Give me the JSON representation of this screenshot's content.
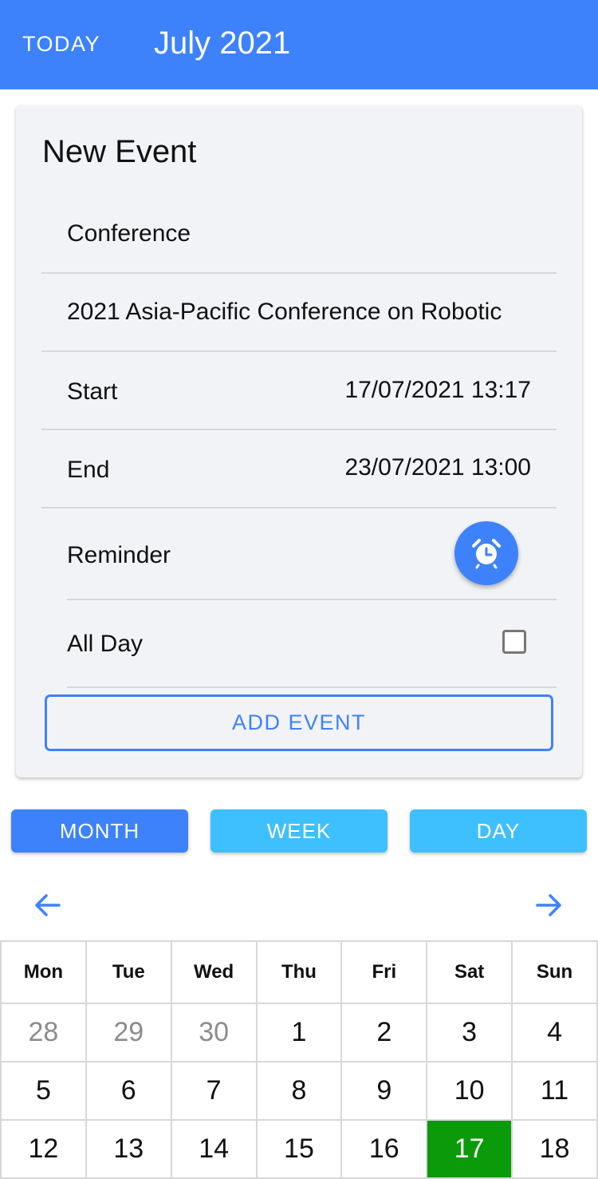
{
  "appbar": {
    "today_label": "TODAY",
    "month_title": "July 2021"
  },
  "form": {
    "heading": "New Event",
    "title_value": "Conference",
    "description_value": "2021 Asia-Pacific Conference on Robotic",
    "start_label": "Start",
    "start_value": "17/07/2021 13:17",
    "end_label": "End",
    "end_value": "23/07/2021 13:00",
    "reminder_label": "Reminder",
    "allday_label": "All Day",
    "allday_checked": false,
    "submit_label": "ADD EVENT"
  },
  "views": {
    "month": "MONTH",
    "week": "WEEK",
    "day": "DAY",
    "selected": "MONTH"
  },
  "calendar": {
    "weekdays": [
      "Mon",
      "Tue",
      "Wed",
      "Thu",
      "Fri",
      "Sat",
      "Sun"
    ],
    "weeks": [
      [
        {
          "d": "28",
          "other": true
        },
        {
          "d": "29",
          "other": true
        },
        {
          "d": "30",
          "other": true
        },
        {
          "d": "1"
        },
        {
          "d": "2"
        },
        {
          "d": "3"
        },
        {
          "d": "4"
        }
      ],
      [
        {
          "d": "5"
        },
        {
          "d": "6"
        },
        {
          "d": "7"
        },
        {
          "d": "8"
        },
        {
          "d": "9"
        },
        {
          "d": "10"
        },
        {
          "d": "11"
        }
      ],
      [
        {
          "d": "12"
        },
        {
          "d": "13"
        },
        {
          "d": "14"
        },
        {
          "d": "15"
        },
        {
          "d": "16"
        },
        {
          "d": "17",
          "today": true
        },
        {
          "d": "18"
        }
      ]
    ],
    "today_color": "#0a9a0a"
  },
  "colors": {
    "primary": "#3d82fa",
    "secondary": "#3fc0fe"
  },
  "icons": {
    "alarm": "alarm-clock-icon",
    "prev": "arrow-left-icon",
    "next": "arrow-right-icon"
  }
}
